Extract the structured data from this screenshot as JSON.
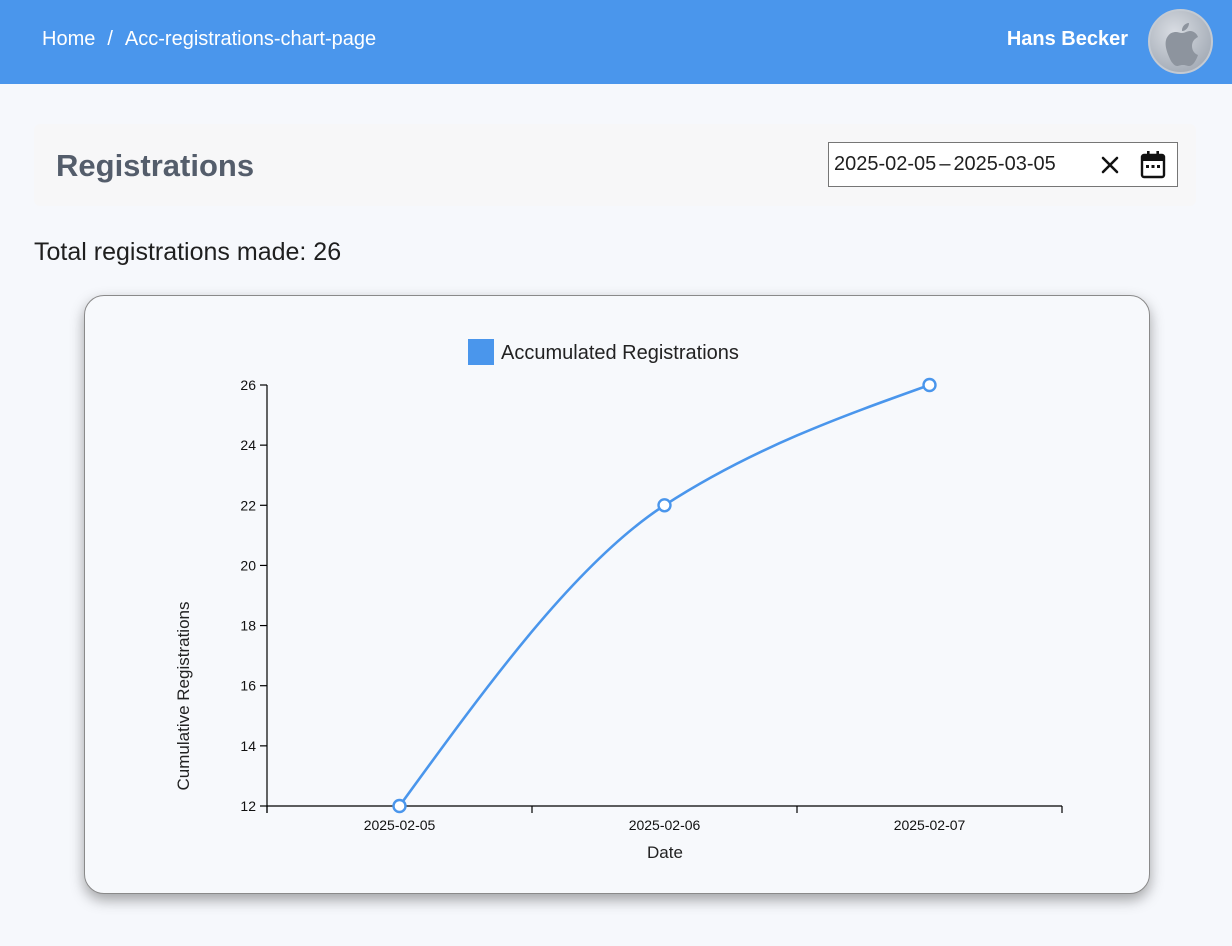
{
  "topbar": {
    "breadcrumb": {
      "home": "Home",
      "separator": "/",
      "current": "Acc-registrations-chart-page"
    },
    "user_name": "Hans Becker",
    "avatar_icon": "apple-logo-icon",
    "background_color": "#4a96ec"
  },
  "header": {
    "title": "Registrations",
    "date_range": {
      "start": "2025-02-05",
      "separator": "–",
      "end": "2025-03-05"
    },
    "clear_icon": "close-icon",
    "calendar_icon": "calendar-icon"
  },
  "summary": {
    "total_text": "Total registrations made: 26"
  },
  "chart_data": {
    "type": "line",
    "title": "",
    "xlabel": "Date",
    "ylabel": "Cumulative Registrations",
    "categories": [
      "2025-02-05",
      "2025-02-06",
      "2025-02-07"
    ],
    "series": [
      {
        "name": "Accumulated Registrations",
        "values": [
          12,
          22,
          26
        ],
        "color": "#4a96ec"
      }
    ],
    "ylim": [
      12,
      26
    ],
    "yticks": [
      12,
      14,
      16,
      18,
      20,
      22,
      24,
      26
    ],
    "legend": "top-center",
    "grid": false,
    "curve": "smooth"
  }
}
